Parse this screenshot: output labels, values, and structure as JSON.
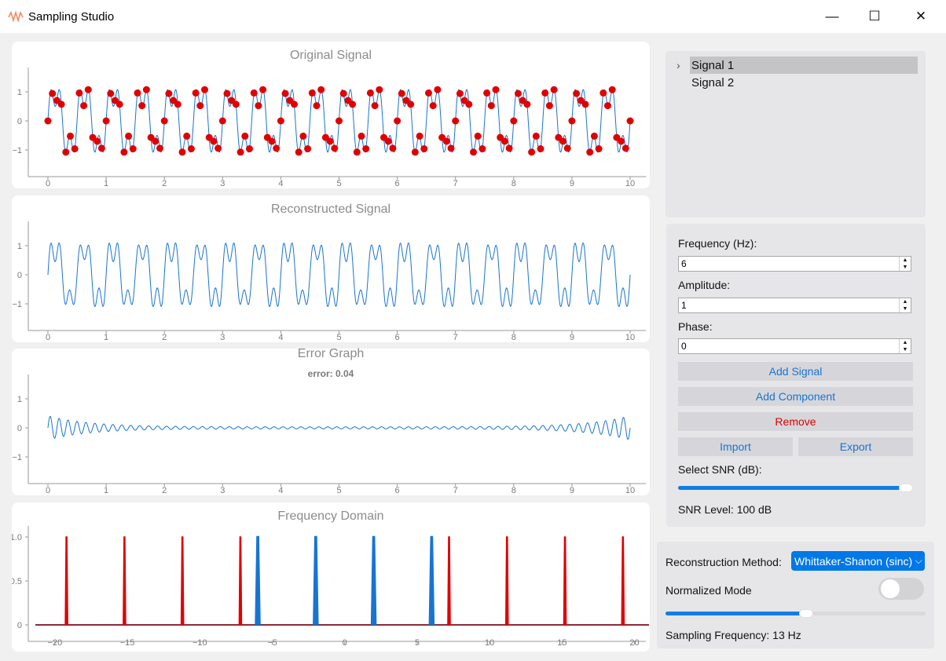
{
  "window": {
    "title": "Sampling Studio",
    "minimize": "—",
    "maximize": "☐",
    "close": "✕"
  },
  "plots": {
    "original": {
      "title": "Original Signal",
      "x_ticks": [
        "0",
        "1",
        "2",
        "3",
        "4",
        "5",
        "6",
        "7",
        "8",
        "9",
        "10"
      ],
      "y_ticks": [
        "1",
        "0",
        "−1"
      ]
    },
    "reconstructed": {
      "title": "Reconstructed Signal",
      "x_ticks": [
        "0",
        "1",
        "2",
        "3",
        "4",
        "5",
        "6",
        "7",
        "8",
        "9",
        "10"
      ],
      "y_ticks": [
        "1",
        "0",
        "−1"
      ]
    },
    "error": {
      "title": "Error Graph",
      "subtitle": "error: 0.04",
      "x_ticks": [
        "0",
        "1",
        "2",
        "3",
        "4",
        "5",
        "6",
        "7",
        "8",
        "9",
        "10"
      ],
      "y_ticks": [
        "1",
        "0",
        "−1"
      ]
    },
    "frequency": {
      "title": "Frequency Domain",
      "x_ticks": [
        "−20",
        "−15",
        "−10",
        "−5",
        "0",
        "5",
        "10",
        "15",
        "20"
      ],
      "y_ticks": [
        "1.0",
        "0.5",
        "0"
      ]
    }
  },
  "chart_data": [
    {
      "type": "line",
      "title": "Original Signal",
      "xlim": [
        0,
        10
      ],
      "ylim": [
        -1.7,
        1.7
      ],
      "sampling_frequency_hz": 13,
      "components_hz": [
        2,
        6
      ],
      "sample_markers": "red dots"
    },
    {
      "type": "line",
      "title": "Reconstructed Signal",
      "xlim": [
        0,
        10
      ],
      "ylim": [
        -1.7,
        1.7
      ]
    },
    {
      "type": "line",
      "title": "Error Graph",
      "subtitle": "error: 0.04",
      "xlim": [
        0,
        10
      ],
      "ylim": [
        -1.7,
        1.7
      ]
    },
    {
      "type": "line",
      "title": "Frequency Domain",
      "xlim": [
        -22,
        21
      ],
      "ylim": [
        0,
        1.05
      ],
      "series": [
        {
          "color": "#1874d2",
          "peaks_x": [
            -6,
            -2,
            2,
            6
          ],
          "peak_y": 1.0
        },
        {
          "color": "#e00000",
          "peaks_x": [
            -19.2,
            -15.2,
            -11.2,
            -7.2,
            7.2,
            11.2,
            15.2,
            19.2
          ],
          "peak_y": 1.0
        }
      ]
    }
  ],
  "signals": {
    "items": [
      "Signal 1",
      "Signal 2"
    ],
    "selected": "Signal 1"
  },
  "controls": {
    "frequency_label": "Frequency (Hz):",
    "frequency_value": "6",
    "amplitude_label": "Amplitude:",
    "amplitude_value": "1",
    "phase_label": "Phase:",
    "phase_value": "0",
    "add_signal": "Add Signal",
    "add_component": "Add Component",
    "remove": "Remove",
    "import": "Import",
    "export": "Export",
    "snr_label": "Select SNR (dB):",
    "snr_level": "SNR Level: 100 dB",
    "snr_fraction": 0.97
  },
  "reconstruction": {
    "method_label": "Reconstruction Method:",
    "method_value": "Whittaker-Shanon (sinc)",
    "normalized_label": "Normalized Mode",
    "normalized_on": false,
    "sampling_fraction": 0.54,
    "sampling_text": "Sampling Frequency: 13 Hz"
  },
  "colors": {
    "accent": "#0f7ee6",
    "signal": "#1874d2",
    "sample": "#e00000",
    "remove": "#e00000"
  }
}
